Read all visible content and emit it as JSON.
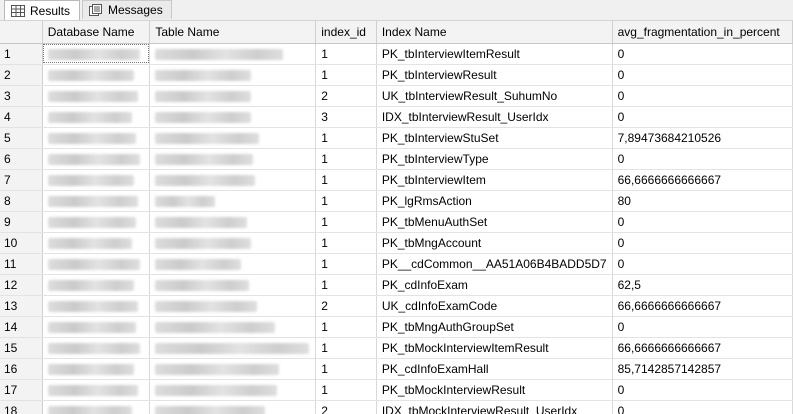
{
  "tabs": [
    {
      "label": "Results",
      "icon": "grid-icon",
      "active": true
    },
    {
      "label": "Messages",
      "icon": "messages-icon",
      "active": false
    }
  ],
  "grid": {
    "columns": [
      "",
      "Database Name",
      "Table Name",
      "index_id",
      "Index Name",
      "avg_fragmentation_in_percent"
    ],
    "rows": [
      {
        "n": "1",
        "index_id": "1",
        "index_name": "PK_tbInterviewItemResult",
        "frag": "0"
      },
      {
        "n": "2",
        "index_id": "1",
        "index_name": "PK_tbInterviewResult",
        "frag": "0"
      },
      {
        "n": "3",
        "index_id": "2",
        "index_name": "UK_tbInterviewResult_SuhumNo",
        "frag": "0"
      },
      {
        "n": "4",
        "index_id": "3",
        "index_name": "IDX_tbInterviewResult_UserIdx",
        "frag": "0"
      },
      {
        "n": "5",
        "index_id": "1",
        "index_name": "PK_tbInterviewStuSet",
        "frag": "7,89473684210526"
      },
      {
        "n": "6",
        "index_id": "1",
        "index_name": "PK_tbInterviewType",
        "frag": "0"
      },
      {
        "n": "7",
        "index_id": "1",
        "index_name": "PK_tbInterviewItem",
        "frag": "66,6666666666667"
      },
      {
        "n": "8",
        "index_id": "1",
        "index_name": "PK_lgRmsAction",
        "frag": "80"
      },
      {
        "n": "9",
        "index_id": "1",
        "index_name": "PK_tbMenuAuthSet",
        "frag": "0"
      },
      {
        "n": "10",
        "index_id": "1",
        "index_name": "PK_tbMngAccount",
        "frag": "0"
      },
      {
        "n": "11",
        "index_id": "1",
        "index_name": "PK__cdCommon__AA51A06B4BADD5D7",
        "frag": "0"
      },
      {
        "n": "12",
        "index_id": "1",
        "index_name": "PK_cdInfoExam",
        "frag": "62,5"
      },
      {
        "n": "13",
        "index_id": "2",
        "index_name": "UK_cdInfoExamCode",
        "frag": "66,6666666666667"
      },
      {
        "n": "14",
        "index_id": "1",
        "index_name": "PK_tbMngAuthGroupSet",
        "frag": "0"
      },
      {
        "n": "15",
        "index_id": "1",
        "index_name": "PK_tbMockInterviewItemResult",
        "frag": "66,6666666666667"
      },
      {
        "n": "16",
        "index_id": "1",
        "index_name": "PK_cdInfoExamHall",
        "frag": "85,7142857142857"
      },
      {
        "n": "17",
        "index_id": "1",
        "index_name": "PK_tbMockInterviewResult",
        "frag": "0"
      },
      {
        "n": "18",
        "index_id": "2",
        "index_name": "IDX_tbMockInterviewResult_UserIdx",
        "frag": "0"
      }
    ]
  }
}
